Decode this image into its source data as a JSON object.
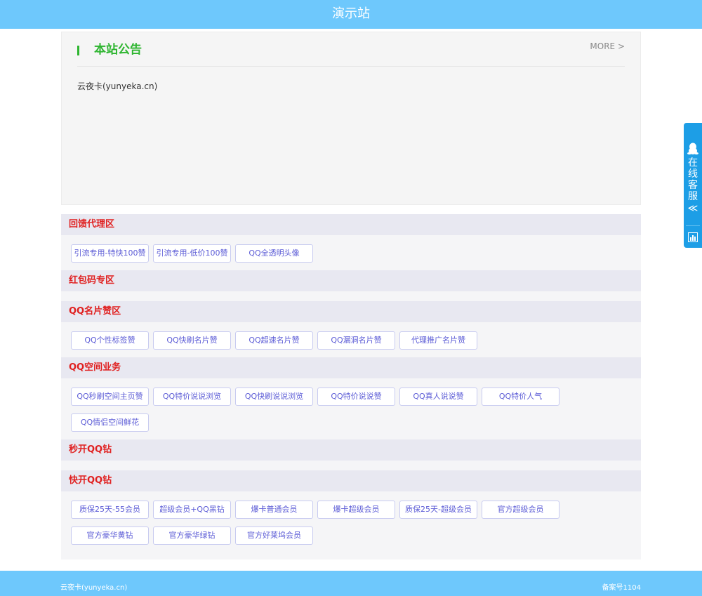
{
  "header": {
    "title": "演示站"
  },
  "notice": {
    "title": "本站公告",
    "more": "MORE >",
    "body": "云夜卡(yunyeka.cn)"
  },
  "categories": [
    {
      "title": "回馈代理区",
      "items": [
        "引流专用-特快100赞",
        "引流专用-低价100赞",
        "QQ全透明头像"
      ]
    },
    {
      "title": "红包码专区",
      "items": []
    },
    {
      "title": "QQ名片赞区",
      "items": [
        "QQ个性标签赞",
        "QQ快刷名片赞",
        "QQ超速名片赞",
        "QQ漏洞名片赞",
        "代理推广名片赞"
      ]
    },
    {
      "title": "QQ空间业务",
      "items": [
        "QQ秒刷空间主页赞",
        "QQ特价说说浏览",
        "QQ快刷说说浏览",
        "QQ特价说说赞",
        "QQ真人说说赞",
        "QQ特价人气",
        "QQ情侣空间鲜花"
      ]
    },
    {
      "title": "秒开QQ钻",
      "items": []
    },
    {
      "title": "快开QQ钻",
      "items": [
        "质保25天-55会员",
        "超级会员+QQ黑钻",
        "爆卡普通会员",
        "爆卡超级会员",
        "质保25天-超级会员",
        "官方超级会员",
        "官方豪华黄钻",
        "官方豪华绿钻",
        "官方好莱坞会员"
      ]
    }
  ],
  "footer": {
    "left": "云夜卡(yunyeka.cn)",
    "right": "备案号1104"
  },
  "kefu": {
    "label": "在线客服",
    "arrow": "≪",
    "icons": [
      "qq-penguin-icon",
      "bar-chart-icon"
    ]
  },
  "colors": {
    "header_bg": "#6ec8fc",
    "notice_title": "#2db52f",
    "category_title": "#e02020",
    "button_text": "#5b5bd6",
    "kefu_bg": "#1d9ee6"
  }
}
